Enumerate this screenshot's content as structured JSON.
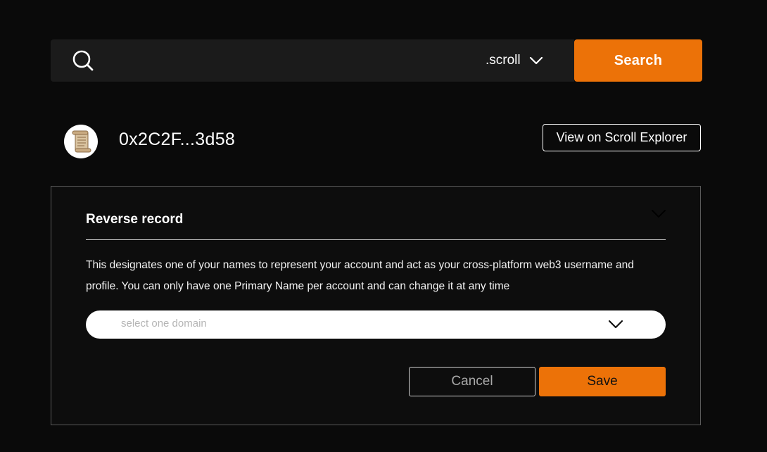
{
  "search": {
    "placeholder": "",
    "value": "",
    "tld": ".scroll",
    "button_label": "Search",
    "accent_color": "#ec7208"
  },
  "account": {
    "avatar_icon": "scroll-icon",
    "address": "0x2C2F...3d58",
    "explorer_button_label": "View on Scroll Explorer"
  },
  "reverse_record": {
    "title": "Reverse record",
    "description": "This designates one of your names to represent your account and act as your cross-platform web3 username and profile. You can only have one Primary Name per account and can change it at any time",
    "domain_select_placeholder": "select one domain",
    "cancel_label": "Cancel",
    "save_label": "Save"
  }
}
